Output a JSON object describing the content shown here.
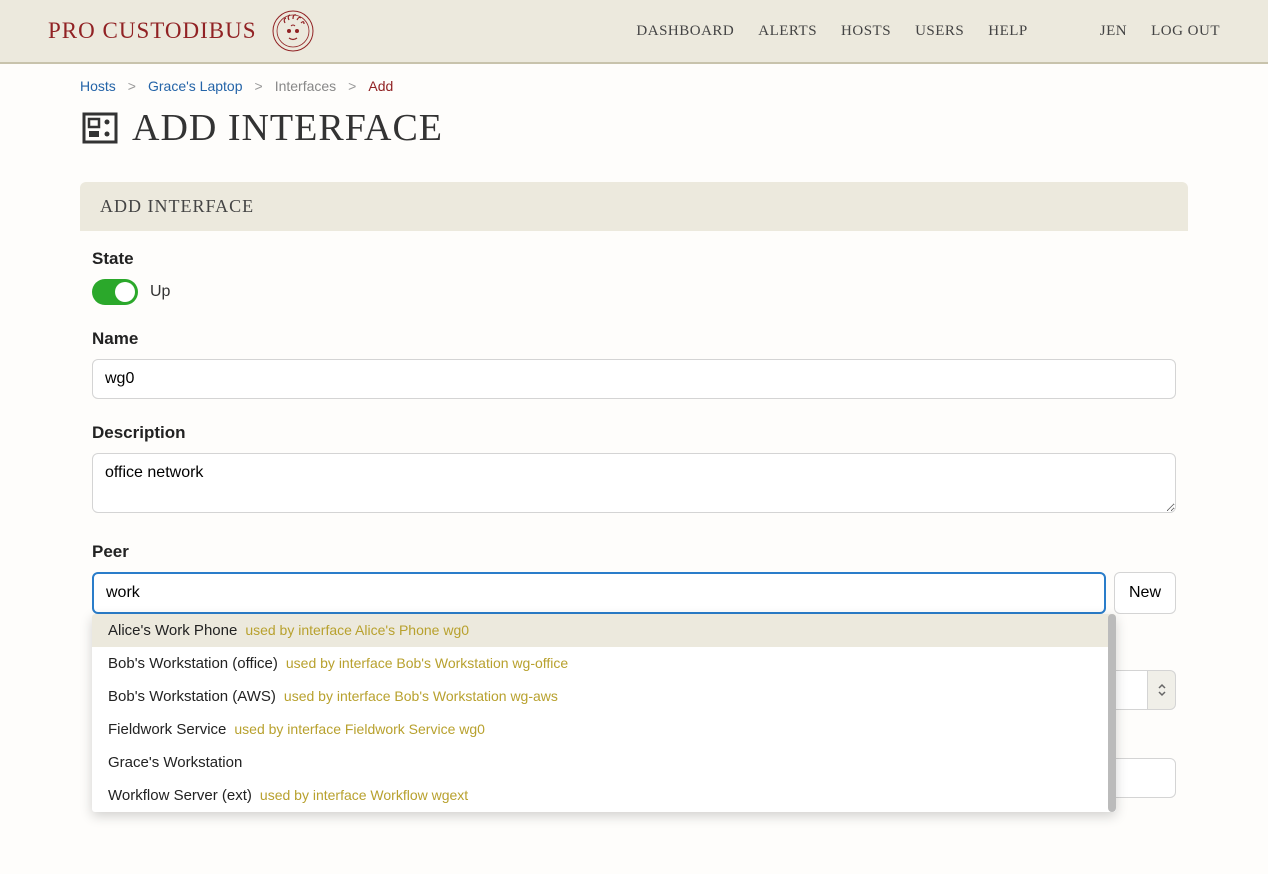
{
  "header": {
    "logo_text": "PRO CUSTODIBUS",
    "nav": {
      "dashboard": "DASHBOARD",
      "alerts": "ALERTS",
      "hosts": "HOSTS",
      "users": "USERS",
      "help": "HELP",
      "user": "JEN",
      "logout": "LOG OUT"
    }
  },
  "breadcrumb": {
    "hosts": "Hosts",
    "host_name": "Grace's Laptop",
    "interfaces": "Interfaces",
    "add": "Add"
  },
  "page_title": "ADD INTERFACE",
  "panel": {
    "header": "ADD INTERFACE",
    "state": {
      "label": "State",
      "value_label": "Up"
    },
    "name": {
      "label": "Name",
      "value": "wg0"
    },
    "description": {
      "label": "Description",
      "value": "office network"
    },
    "peer": {
      "label": "Peer",
      "value": "work",
      "new_button": "New",
      "options": [
        {
          "name": "Alice's Work Phone",
          "sub": "used by interface Alice's Phone wg0",
          "highlighted": true
        },
        {
          "name": "Bob's Workstation (office)",
          "sub": "used by interface Bob's Workstation wg-office",
          "highlighted": false
        },
        {
          "name": "Bob's Workstation (AWS)",
          "sub": "used by interface Bob's Workstation wg-aws",
          "highlighted": false
        },
        {
          "name": "Fieldwork Service",
          "sub": "used by interface Fieldwork Service wg0",
          "highlighted": false
        },
        {
          "name": "Grace's Workstation",
          "sub": "",
          "highlighted": false
        },
        {
          "name": "Workflow Server (ext)",
          "sub": "used by interface Workflow wgext",
          "highlighted": false
        }
      ]
    }
  }
}
